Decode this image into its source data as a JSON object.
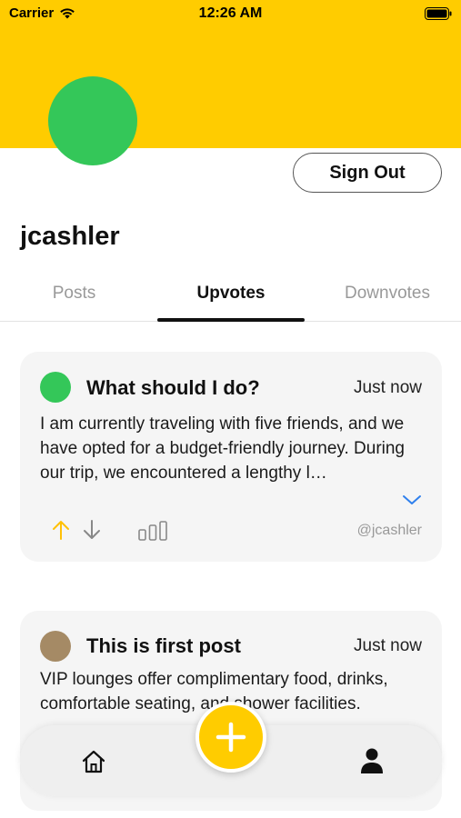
{
  "status_bar": {
    "carrier": "Carrier",
    "time": "12:26 AM"
  },
  "colors": {
    "accent": "#ffcc00",
    "avatar_green": "#34c759",
    "avatar_brown": "#a58a65"
  },
  "profile": {
    "username": "jcashler",
    "sign_out_label": "Sign Out"
  },
  "tabs": [
    {
      "label": "Posts",
      "active": false
    },
    {
      "label": "Upvotes",
      "active": true
    },
    {
      "label": "Downvotes",
      "active": false
    }
  ],
  "posts": [
    {
      "title": "What should I do?",
      "time": "Just now",
      "body": "I am currently traveling with five friends, and we have opted for a budget-friendly journey. During our trip, we encountered a lengthy l…",
      "author": "@jcashler",
      "avatar_color": "#34c759",
      "icons": [
        "upvote-icon",
        "downvote-icon",
        "stats-icon",
        "expand-icon"
      ]
    },
    {
      "title": "This is first post",
      "time": "Just now",
      "body": "VIP lounges offer complimentary food, drinks, comfortable seating, and shower facilities.",
      "avatar_color": "#a58a65"
    }
  ],
  "bottom_nav": {
    "items": [
      "home-icon",
      "add-post-button",
      "profile-icon"
    ]
  }
}
